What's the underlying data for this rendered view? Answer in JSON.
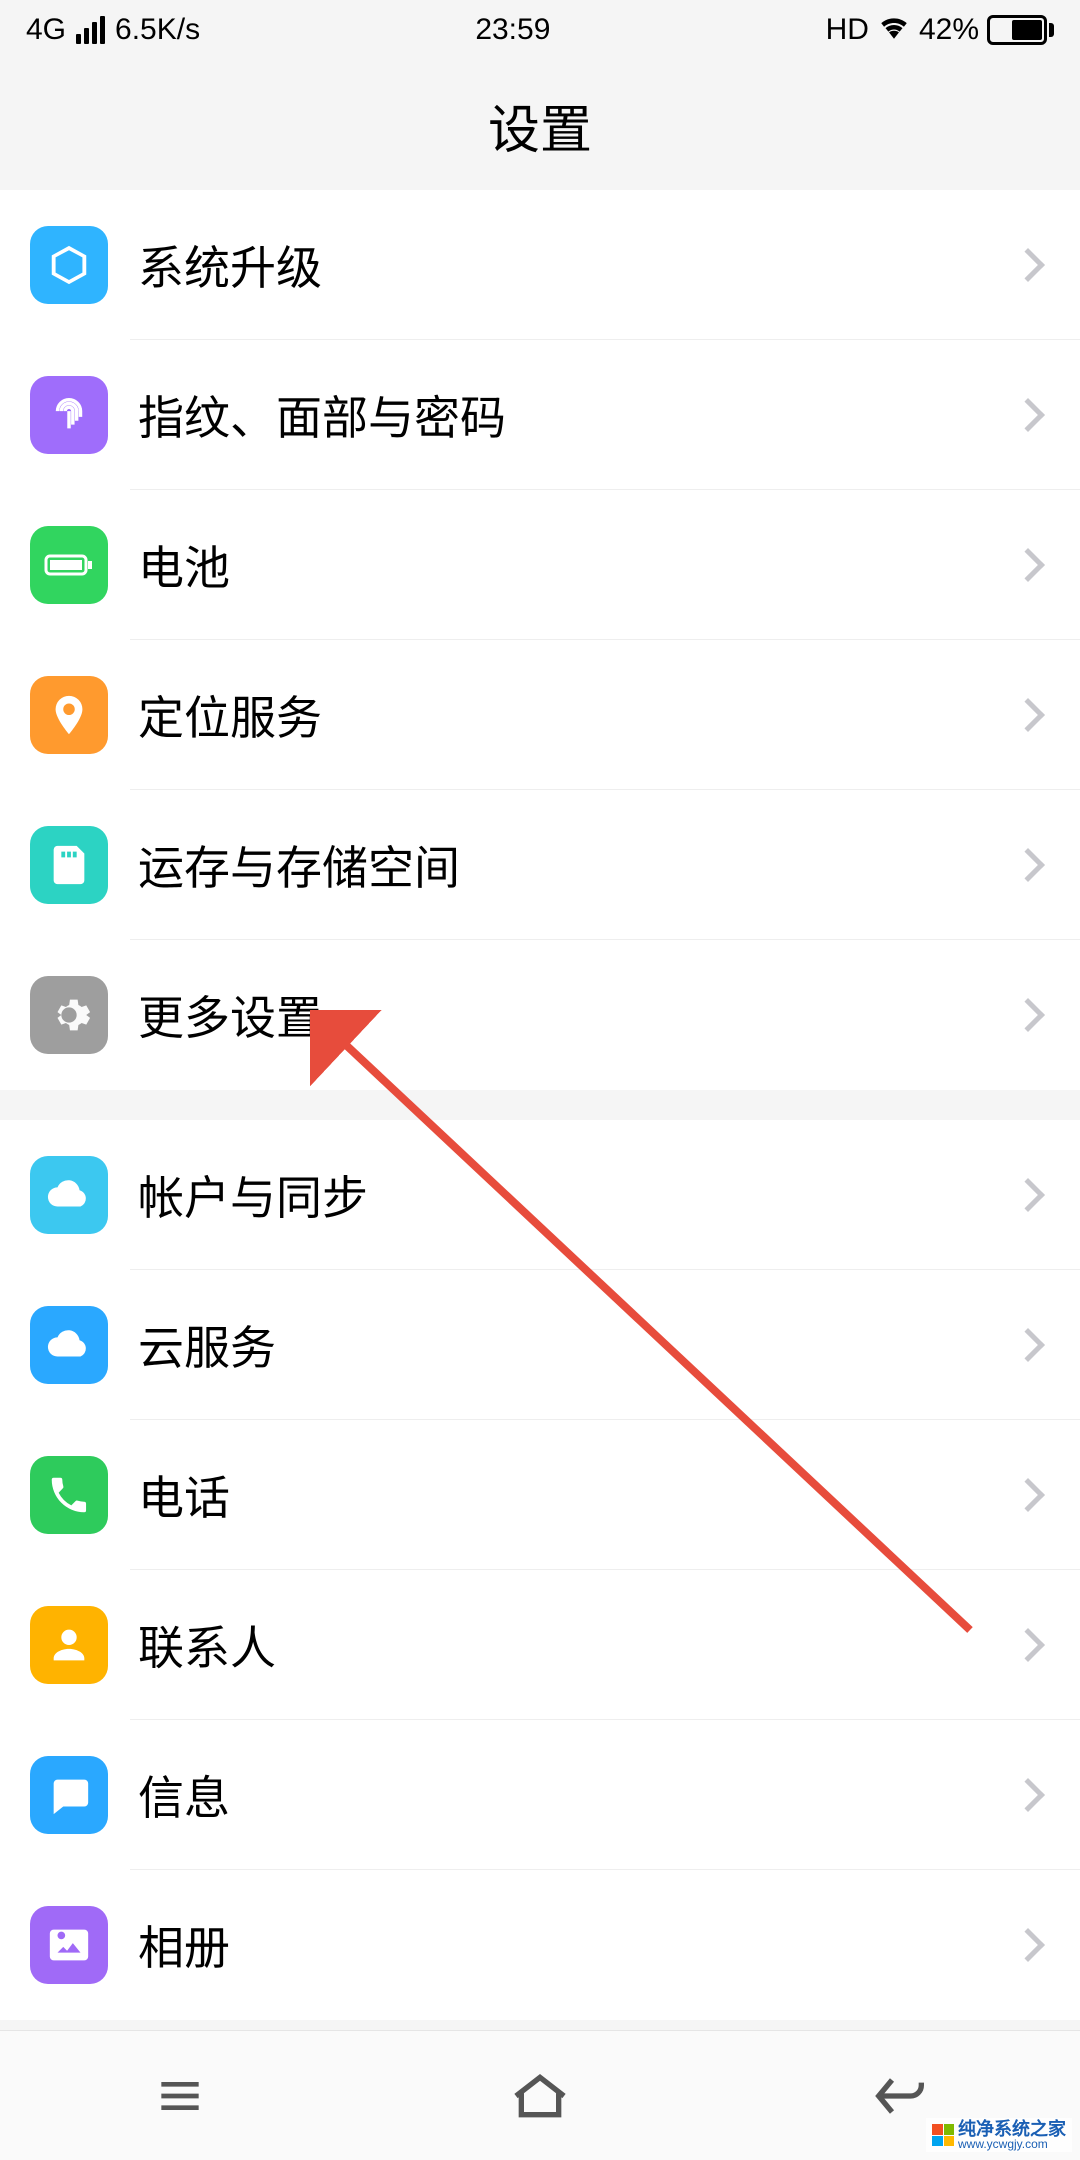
{
  "status": {
    "network": "4G",
    "speed": "6.5K/s",
    "time": "23:59",
    "hd": "HD",
    "battery_pct": "42%"
  },
  "header": {
    "title": "设置"
  },
  "groups": [
    {
      "items": [
        {
          "id": "system-update",
          "label": "系统升级",
          "icon": "cube-icon",
          "bg": "#2fb4ff"
        },
        {
          "id": "fingerprint-face-password",
          "label": "指纹、面部与密码",
          "icon": "fingerprint-icon",
          "bg": "#9f6dfb"
        },
        {
          "id": "battery",
          "label": "电池",
          "icon": "battery-icon",
          "bg": "#31d55f"
        },
        {
          "id": "location",
          "label": "定位服务",
          "icon": "location-icon",
          "bg": "#ff9a2e"
        },
        {
          "id": "storage",
          "label": "运存与存储空间",
          "icon": "sd-card-icon",
          "bg": "#2cd3c3"
        },
        {
          "id": "more-settings",
          "label": "更多设置",
          "icon": "gear-icon",
          "bg": "#9e9e9e"
        }
      ]
    },
    {
      "items": [
        {
          "id": "account-sync",
          "label": "帐户与同步",
          "icon": "cloud-sync-icon",
          "bg": "#3cc8f0"
        },
        {
          "id": "cloud-service",
          "label": "云服务",
          "icon": "cloud-icon",
          "bg": "#2aa8ff"
        },
        {
          "id": "phone",
          "label": "电话",
          "icon": "phone-icon",
          "bg": "#2ecb5c"
        },
        {
          "id": "contacts",
          "label": "联系人",
          "icon": "person-icon",
          "bg": "#ffb300"
        },
        {
          "id": "messages",
          "label": "信息",
          "icon": "message-icon",
          "bg": "#2aa8ff"
        },
        {
          "id": "gallery",
          "label": "相册",
          "icon": "picture-icon",
          "bg": "#a06af7"
        }
      ]
    }
  ],
  "watermark": {
    "name": "纯净系统之家",
    "url": "www.ycwgjy.com"
  },
  "annotation": {
    "target": "more-settings"
  }
}
